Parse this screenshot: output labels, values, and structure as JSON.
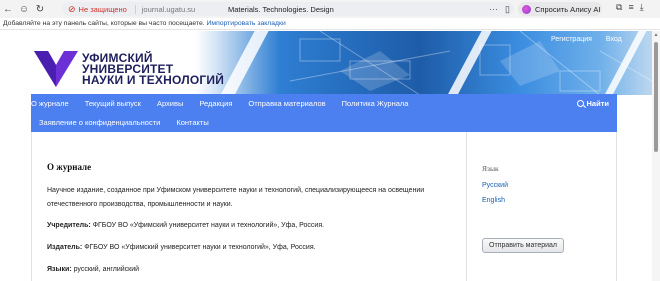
{
  "browser": {
    "security_warning": "Не защищено",
    "domain": "journal.ugatu.su",
    "page_title": "Materials. Technologies. Design",
    "assistant_button": "Спросить Алису AI"
  },
  "bookmark_bar": {
    "hint": "Добавляйте на эту панель сайты, которые вы часто посещаете.",
    "import_link": "Импортировать закладки"
  },
  "header": {
    "logo_lines": [
      "УФИМСКИЙ",
      "УНИВЕРСИТЕТ",
      "НАУКИ И ТЕХНОЛОГИЙ"
    ],
    "register": "Регистрация",
    "login": "Вход"
  },
  "nav": {
    "row1": [
      "О журнале",
      "Текущий выпуск",
      "Архивы",
      "Редакция",
      "Отправка материалов",
      "Политика Журнала"
    ],
    "row2": [
      "Заявление о конфиденциальности",
      "Контакты"
    ],
    "search": "Найти"
  },
  "main": {
    "title": "О журнале",
    "description": "Научное издание, созданное при Уфимском университете науки и технологий, специализирующееся на освещении отечественного производства, промышленности и науки.",
    "founder_label": "Учредитель:",
    "founder_value": " ФГБОУ ВО «Уфимский университет науки и технологий», Уфа, Россия.",
    "publisher_label": "Издатель:",
    "publisher_value": " ФГБОУ ВО «Уфимский университет науки и технологий», Уфа, Россия.",
    "languages_label": "Языки:",
    "languages_value": " русский, английский"
  },
  "sidebar": {
    "language_title": "Язык",
    "languages": [
      "Русский",
      "English"
    ],
    "submit_button": "Отправить материал"
  },
  "colors": {
    "nav_background": "#4c7ff0",
    "link": "#1a5fb4",
    "logo_purple": "#6d2fd6",
    "logo_text": "#1f1f5c"
  }
}
